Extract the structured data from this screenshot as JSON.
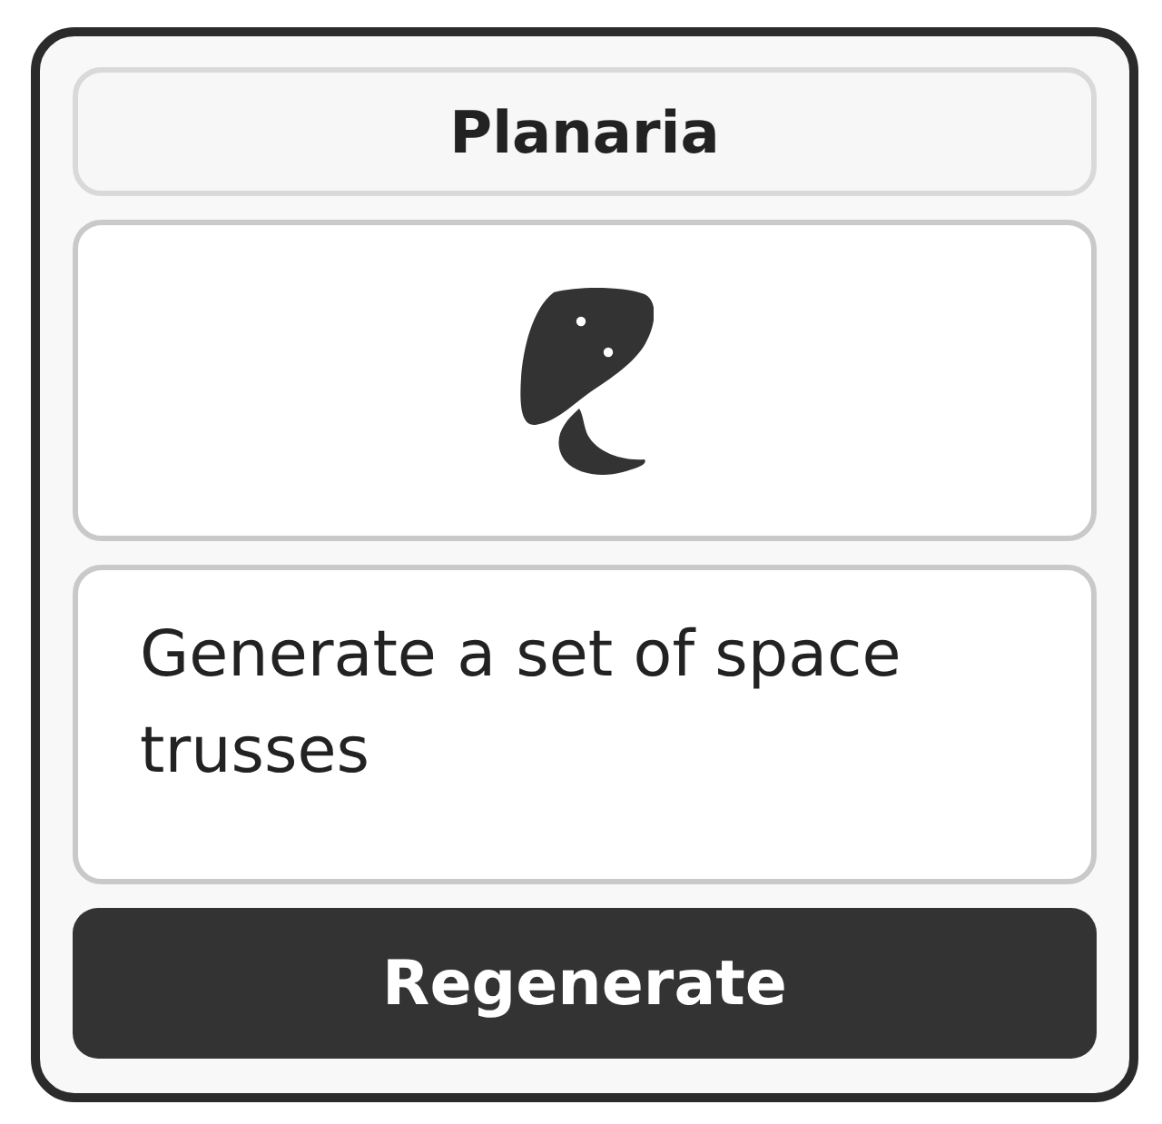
{
  "title": "Planaria",
  "prompt": "Generate a set of space trusses",
  "button": {
    "label": "Regenerate"
  }
}
